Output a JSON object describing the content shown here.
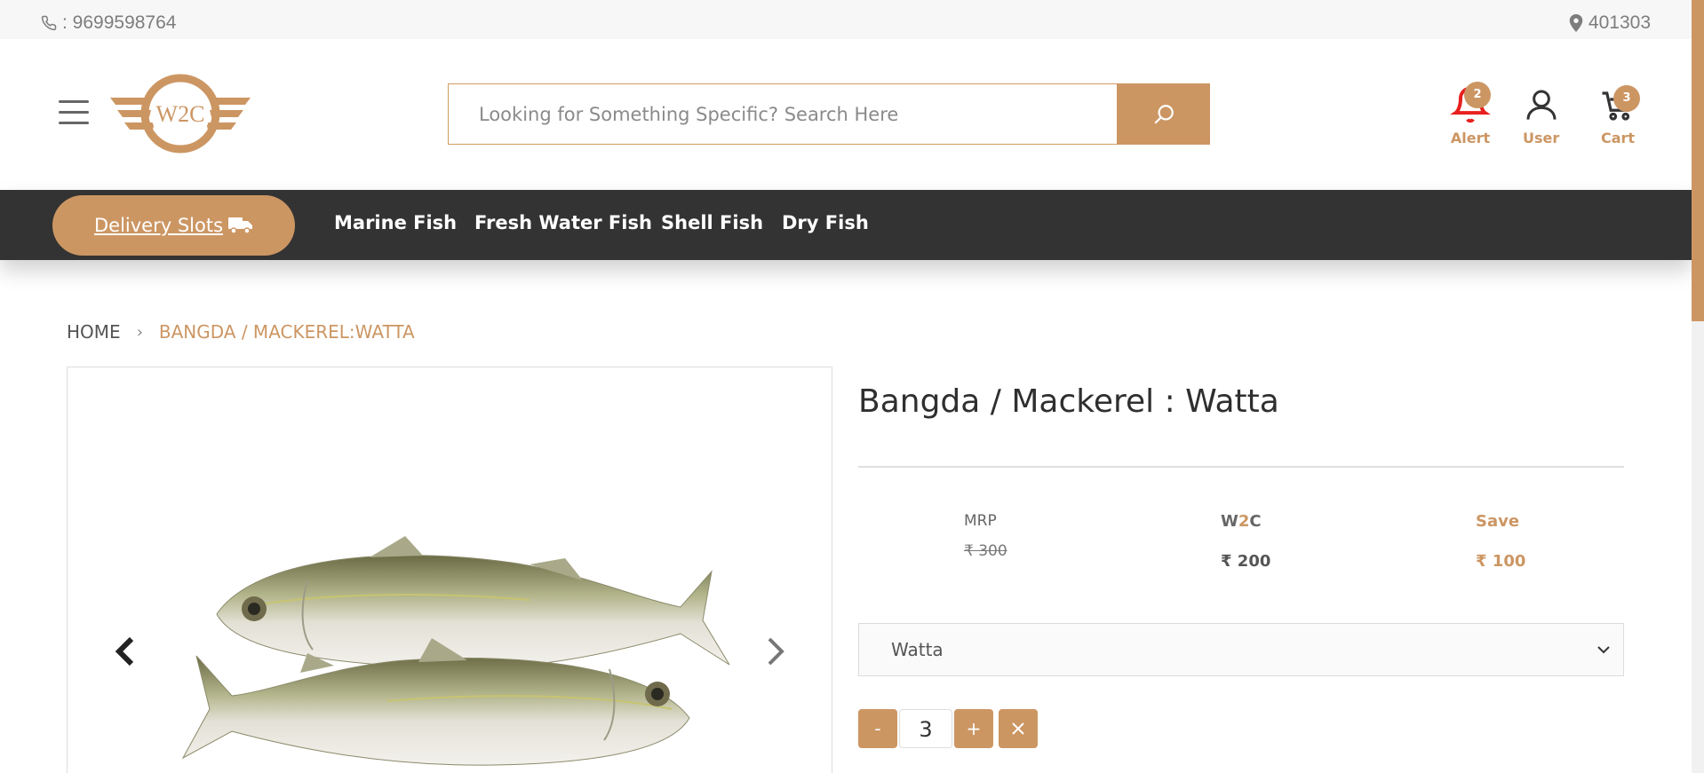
{
  "topbar": {
    "phone": ": 9699598764",
    "pincode": "401303"
  },
  "header": {
    "logo_text": "W2C",
    "search_placeholder": "Looking for Something Specific? Search Here",
    "alert_label": "Alert",
    "alert_count": "2",
    "user_label": "User",
    "cart_label": "Cart",
    "cart_count": "3"
  },
  "nav": {
    "delivery_label": "Delivery Slots",
    "links": [
      "Marine Fish",
      "Fresh Water Fish",
      "Shell Fish",
      "Dry Fish"
    ]
  },
  "breadcrumb": {
    "home": "HOME",
    "current": "BANGDA / MACKEREL:WATTA"
  },
  "product": {
    "title": "Bangda / Mackerel : Watta",
    "mrp_label": "MRP",
    "mrp_value": "₹ 300",
    "w2c_label_a": "W",
    "w2c_label_b": "2",
    "w2c_label_c": "C",
    "w2c_value": "₹ 200",
    "save_label": "Save",
    "save_value": "₹ 100",
    "variant": "Watta",
    "quantity": "3",
    "minus_label": "-",
    "plus_label": "+"
  },
  "colors": {
    "accent": "#cc9663",
    "navbar": "#333333",
    "alert_red": "#e8201e"
  }
}
